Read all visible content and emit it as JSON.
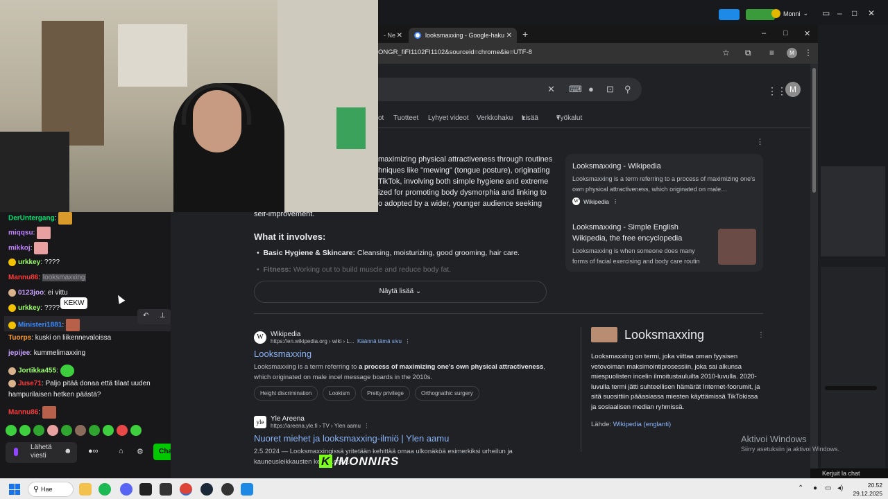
{
  "obs_bar": {
    "user_name": "Monni"
  },
  "browser": {
    "tabs": [
      {
        "label": "- Ne"
      },
      {
        "label": "looksmaxxing - Google-haku"
      }
    ],
    "url": "ONGR_fiFI1102FI1102&sourceid=chrome&ie=UTF-8",
    "account_initial": "M"
  },
  "google": {
    "filters": [
      "ot",
      "Tuotteet",
      "Lyhyet videot",
      "Verkkohaku",
      "Lisää",
      "Työkalut"
    ],
    "ai_overview_lines": [
      "maximizing physical attractiveness through routines",
      "hniques like \"mewing\" (tongue posture), originating",
      "TikTok, involving both simple hygiene and extreme",
      "ized for promoting body dysmorphia and linking to",
      "o adopted by a wider, younger audience seeking",
      "self-improvement."
    ],
    "what_heading": "What it involves:",
    "bullets": [
      {
        "bold": "Basic Hygiene & Skincare:",
        "text": " Cleansing, moisturizing, good grooming, hair care."
      },
      {
        "bold": "Fitness:",
        "text": " Working out to build muscle and reduce body fat."
      }
    ],
    "show_more": "Näytä lisää",
    "side_cards": [
      {
        "title": "Looksmaxxing - Wikipedia",
        "desc": "Looksmaxxing is a term referring to a process of maximizing one's own physical attractiveness, which originated on male…",
        "source": "Wikipedia"
      },
      {
        "title": "Looksmaxxing - Simple English Wikipedia, the free encyclopedia",
        "desc": "Looksmaxxing is when someone does many forms of facial exercising and body care routin"
      }
    ],
    "results": [
      {
        "site": "Wikipedia",
        "url": "https://en.wikipedia.org › wiki › L...",
        "translate": "Käännä tämä sivu",
        "title": "Looksmaxxing",
        "snippet_pre": "Looksmaxxing is a term referring to ",
        "snippet_bold": "a process of maximizing one's own physical attractiveness",
        "snippet_post": ", which originated on male incel message boards in the 2010s.",
        "chips": [
          "Height discrimination",
          "Lookism",
          "Pretty privilege",
          "Orthognathic surgery"
        ]
      },
      {
        "site": "Yle Areena",
        "url": "https://areena.yle.fi › TV › Ylen aamu",
        "title": "Nuoret miehet ja looksmaxxing-ilmiö | Ylen aamu",
        "snippet": "2.5.2024 — Looksmaxxingissä yritetään kehittää omaa ulkonäköä esimerkiksi urheilun ja kauneusleikkausten ke... ...ensa."
      }
    ],
    "knowledge_panel": {
      "title": "Looksmaxxing",
      "body": "Looksmaxxing on termi, joka viittaa oman fyysisen vetovoiman maksimointiprosessiin, joka sai alkunsa miespuolisten incelin ilmoitustauluilta 2010-luvulla. 2020-luvulla termi jätti suhteellisen hämärät Internet-foorumit, ja sitä suosittiin pääasiassa miesten käyttämissä TikTokissa ja sosiaalisen median ryhmissä.",
      "source_label": "Lähde:",
      "source_link": "Wikipedia (englanti)"
    }
  },
  "windows_activation": {
    "title": "Aktivoi Windows",
    "subtitle": "Siirry asetuksiin ja aktivoi Windows."
  },
  "chat": {
    "messages": [
      {
        "user": "DerUntergang",
        "color": "#00e070",
        "text": ""
      },
      {
        "user": "miqqsu",
        "color": "#c080ff",
        "text": ""
      },
      {
        "user": "mikkoj",
        "color": "#c080ff",
        "text": ""
      },
      {
        "user": "urkkey",
        "color": "#9bff6a",
        "text": "????"
      },
      {
        "user": "Mannu86",
        "color": "#ff3a3a",
        "text": "looksmaxxing"
      },
      {
        "user": "0123joo",
        "color": "#c8a0ff",
        "text": "ei vittu"
      },
      {
        "user": "urkkey",
        "color": "#9bff6a",
        "text": "????"
      },
      {
        "user": "Ministeri1881",
        "color": "#3a8bff",
        "text": ""
      },
      {
        "user": "Tuorps",
        "color": "#ff9d2e",
        "text": "kuski on liikennevaloissa"
      },
      {
        "user": "jepijee",
        "color": "#c8a0ff",
        "text": "kummelimaxxing"
      },
      {
        "user": "Jortikka455",
        "color": "#9bff6a",
        "text": ""
      },
      {
        "user": "Juse71",
        "color": "#ff3a3a",
        "text": "Paljo pitää donaa että tilaat uuden"
      },
      {
        "user": "",
        "color": "#efeff1",
        "text": "hampurilaisen hetken päästä?"
      },
      {
        "user": "Mannu86",
        "color": "#ff3a3a",
        "text": ""
      }
    ],
    "tooltip": "KEKW",
    "input_placeholder": "Lähetä viesti",
    "chat_button": "Chat"
  },
  "overlay_logo": {
    "k": "K",
    "text": "/MONNIRS"
  },
  "caption_text": "Kerjuit la chat",
  "taskbar": {
    "search_label": "Hae",
    "time": "20.52",
    "date": "29.12.2025"
  }
}
